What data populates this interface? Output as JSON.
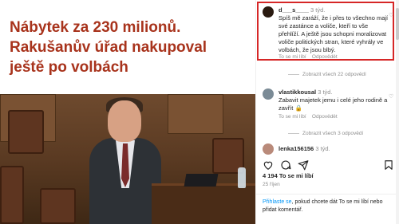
{
  "post": {
    "headline_line1": "Nábytek za 230 milionů.",
    "headline_line2": "Rakušanův úřad nakupoval",
    "headline_line3": "ještě po volbách"
  },
  "comments": [
    {
      "username": "d___s____",
      "time": "3 týd.",
      "text": "Spíš mě zaráží, že i přes to všechno mají své zastánce a voliče, kteří to vše přehlíží. A ještě jsou schopni moralizovat voliče politických stran, které vyhrály ve volbách, že jsou blbý.",
      "like_label": "To se mi líbí",
      "reply_label": "Odpovědět",
      "replies_label": "Zobrazit všech 22 odpovědí"
    },
    {
      "username": "vlastikkousal",
      "time": "3 týd.",
      "text": "Zabavit majetek jemu i celé jeho rodině a zavřít",
      "emoji": "🔒",
      "like_label": "To se mi líbí",
      "reply_label": "Odpovědět",
      "replies_label": "Zobrazit všech 3 odpovědí"
    },
    {
      "username": "lenka156156",
      "time": "3 týd."
    }
  ],
  "post_meta": {
    "likes": "4 194 To se mi líbí",
    "date": "25 říjen"
  },
  "login": {
    "link_text": "Přihlaste se",
    "rest_text": ", pokud chcete dát To se mi líbí nebo přidat komentář."
  },
  "colors": {
    "headline": "#a8331c",
    "highlight_border": "#d62727",
    "link": "#0095f6"
  },
  "icons": [
    "heart-icon",
    "comment-icon",
    "share-icon",
    "bookmark-icon"
  ]
}
